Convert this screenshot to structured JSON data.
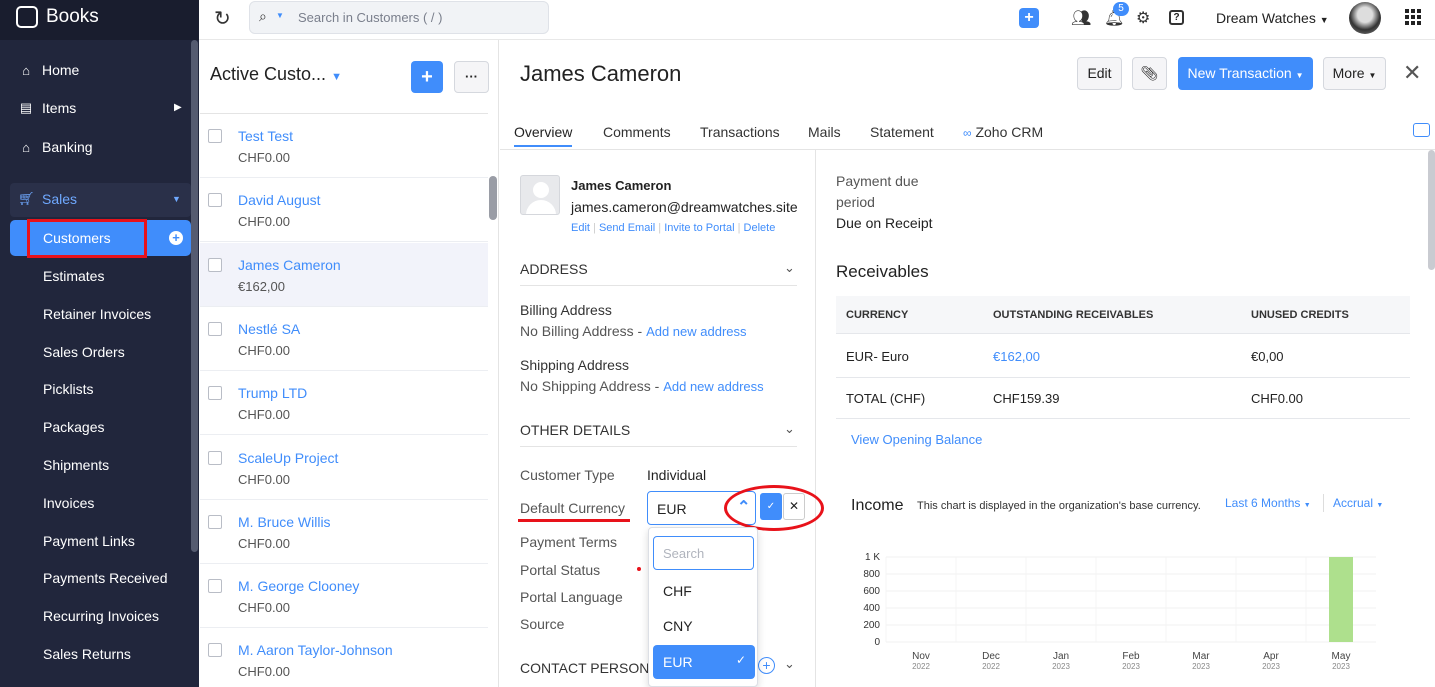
{
  "app": {
    "name": "Books"
  },
  "colors": {
    "accent": "#408dfb",
    "sidebar_bg": "#21263c",
    "highlight": "#e8121a"
  },
  "sidebar": {
    "items": [
      {
        "label": "Home",
        "icon": "home-icon"
      },
      {
        "label": "Items",
        "icon": "items-icon"
      },
      {
        "label": "Banking",
        "icon": "bank-icon"
      },
      {
        "label": "Sales",
        "icon": "cart-icon"
      }
    ],
    "sales_sub": [
      "Customers",
      "Estimates",
      "Retainer Invoices",
      "Sales Orders",
      "Picklists",
      "Packages",
      "Shipments",
      "Invoices",
      "Payment Links",
      "Payments Received",
      "Recurring Invoices",
      "Sales Returns"
    ]
  },
  "topbar": {
    "search_placeholder": "Search in Customers ( / )",
    "org": "Dream Watches",
    "notif_count": "5"
  },
  "list": {
    "title": "Active Custo...",
    "rows": [
      {
        "name": "Test Test",
        "amount": "CHF0.00"
      },
      {
        "name": "David August",
        "amount": "CHF0.00"
      },
      {
        "name": "James Cameron",
        "amount": "€162,00"
      },
      {
        "name": "Nestlé SA",
        "amount": "CHF0.00"
      },
      {
        "name": "Trump LTD",
        "amount": "CHF0.00"
      },
      {
        "name": "ScaleUp Project",
        "amount": "CHF0.00"
      },
      {
        "name": "M. Bruce Willis",
        "amount": "CHF0.00"
      },
      {
        "name": "M. George Clooney",
        "amount": "CHF0.00"
      },
      {
        "name": "M. Aaron Taylor-Johnson",
        "amount": "CHF0.00"
      }
    ]
  },
  "detail": {
    "name": "James Cameron",
    "buttons": {
      "edit": "Edit",
      "new_txn": "New Transaction",
      "more": "More"
    },
    "tabs": [
      "Overview",
      "Comments",
      "Transactions",
      "Mails",
      "Statement",
      "Zoho CRM"
    ],
    "contact": {
      "name": "James Cameron",
      "email": "james.cameron@dreamwatches.site",
      "actions": [
        "Edit",
        "Send Email",
        "Invite to Portal",
        "Delete"
      ]
    },
    "address": {
      "heading": "ADDRESS",
      "billing_label": "Billing Address",
      "billing_value": "No Billing Address -",
      "billing_link": "Add new address",
      "shipping_label": "Shipping Address",
      "shipping_value": "No Shipping Address -",
      "shipping_link": "Add new address"
    },
    "other": {
      "heading": "OTHER DETAILS",
      "customer_type_label": "Customer Type",
      "customer_type": "Individual",
      "currency_label": "Default Currency",
      "currency_value": "EUR",
      "payment_terms": "Payment Terms",
      "portal_status": "Portal Status",
      "portal_language": "Portal Language",
      "source": "Source",
      "contact_persons": "CONTACT PERSONS"
    },
    "currency_dropdown": {
      "search_placeholder": "Search",
      "options": [
        "CHF",
        "CNY",
        "EUR"
      ],
      "selected": "EUR"
    }
  },
  "right": {
    "payment_due_label": "Payment due\nperiod",
    "payment_due_l1": "Payment due",
    "payment_due_l2": "period",
    "payment_due_value": "Due on Receipt",
    "receivables_title": "Receivables",
    "table": {
      "headers": [
        "CURRENCY",
        "OUTSTANDING RECEIVABLES",
        "UNUSED CREDITS"
      ],
      "rows": [
        [
          "EUR- Euro",
          "€162,00",
          "€0,00"
        ],
        [
          "TOTAL (CHF)",
          "CHF159.39",
          "CHF0.00"
        ]
      ]
    },
    "opening_balance": "View Opening Balance",
    "income": {
      "title": "Income",
      "note": "This chart is displayed in the organization's base currency.",
      "period": "Last 6 Months",
      "basis": "Accrual"
    }
  },
  "chart_data": {
    "type": "bar",
    "categories": [
      "Nov 2022",
      "Dec 2022",
      "Jan 2023",
      "Feb 2023",
      "Mar 2023",
      "Apr 2023",
      "May 2023"
    ],
    "x_labels": [
      [
        "Nov",
        "2022"
      ],
      [
        "Dec",
        "2022"
      ],
      [
        "Jan",
        "2023"
      ],
      [
        "Feb",
        "2023"
      ],
      [
        "Mar",
        "2023"
      ],
      [
        "Apr",
        "2023"
      ],
      [
        "May",
        "2023"
      ]
    ],
    "values": [
      0,
      0,
      0,
      0,
      0,
      0,
      1000
    ],
    "y_ticks": [
      "1 K",
      "800",
      "600",
      "400",
      "200",
      "0"
    ],
    "ylim": [
      0,
      1000
    ],
    "bar_color": "#aee08d"
  }
}
